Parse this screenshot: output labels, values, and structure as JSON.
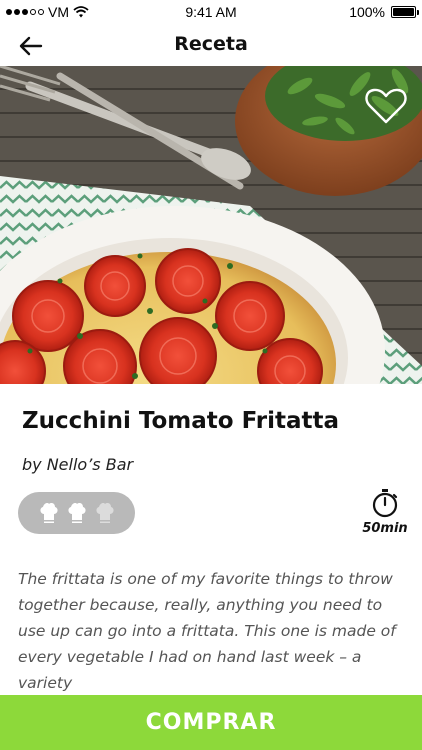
{
  "status_bar": {
    "carrier": "VM",
    "time": "9:41 AM",
    "battery": "100%"
  },
  "nav": {
    "title": "Receta",
    "back_icon": "back-arrow-icon"
  },
  "hero": {
    "favorite_icon": "heart-outline-icon"
  },
  "recipe": {
    "title": "Zucchini Tomato Fritatta",
    "author": "by Nello’s Bar",
    "difficulty_icon": "chef-hat-icon",
    "difficulty_level": 2,
    "difficulty_max": 3,
    "time": "50min",
    "time_icon": "stopwatch-icon",
    "description": "The frittata is one of my favorite things to throw together because, really, anything you need to use up can go into a frittata. This one is made of every vegetable I had on hand last week – a variety"
  },
  "buy_button": {
    "label": "COMPRAR"
  },
  "colors": {
    "accent": "#8dd93a",
    "pill": "#b9b9b9"
  }
}
